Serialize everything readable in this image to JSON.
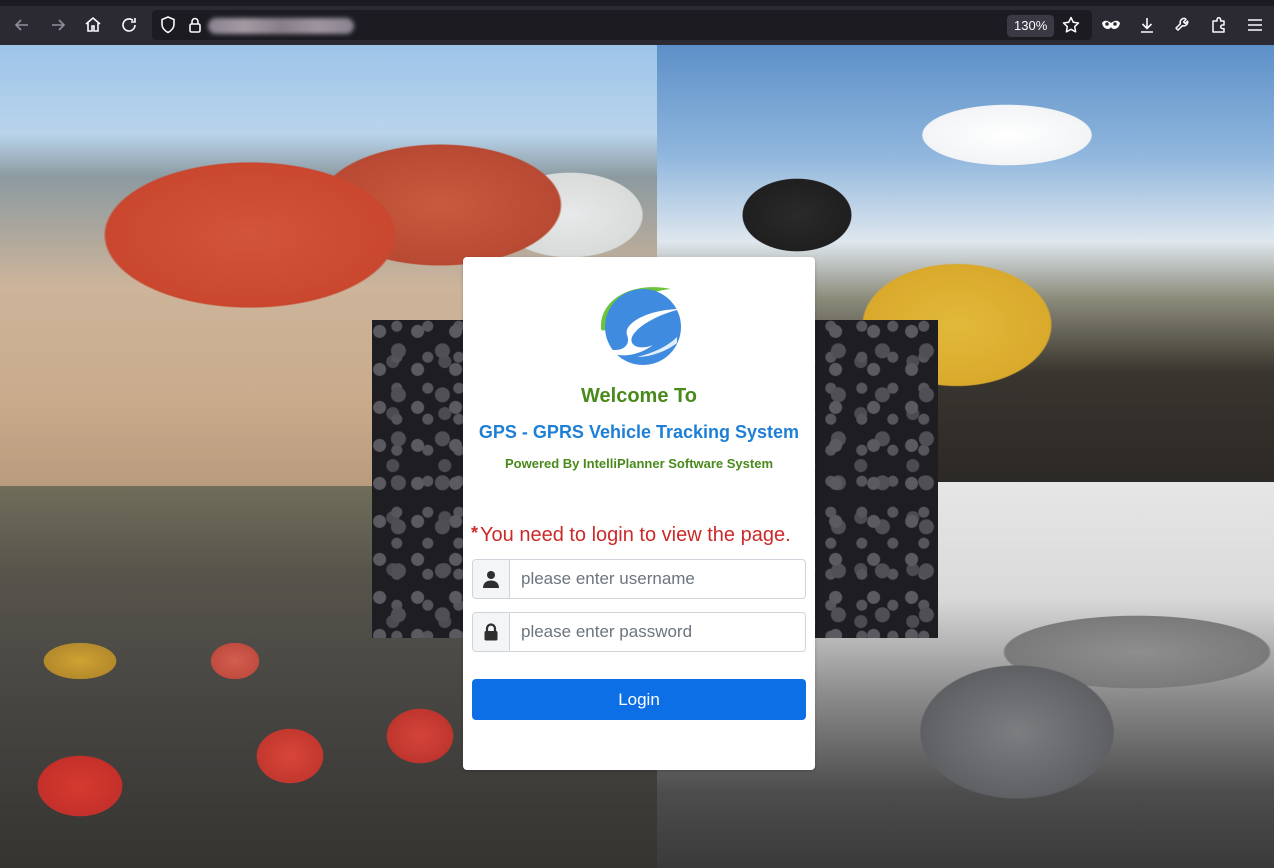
{
  "browser": {
    "zoom": "130%",
    "icons": {
      "back": "arrow-left-icon",
      "forward": "arrow-right-icon",
      "home": "home-icon",
      "reload": "reload-icon",
      "shield": "shield-icon",
      "lock": "lock-icon",
      "bookmark": "star-icon",
      "private": "mask-icon",
      "downloads": "download-icon",
      "tools": "wrench-icon",
      "extensions": "puzzle-icon",
      "menu": "hamburger-menu-icon"
    }
  },
  "login": {
    "welcome": "Welcome To",
    "system_name": "GPS - GPRS Vehicle Tracking System",
    "powered_by": "Powered By IntelliPlanner Software System",
    "notice_marker": "*",
    "notice": "You need to login to view the page.",
    "username_placeholder": "please enter username",
    "password_placeholder": "please enter password",
    "login_label": "Login"
  },
  "colors": {
    "welcome_green": "#4a8a1c",
    "system_blue": "#1e7fd6",
    "notice_red": "#cc2a2a",
    "button_blue": "#0d6fe6"
  }
}
